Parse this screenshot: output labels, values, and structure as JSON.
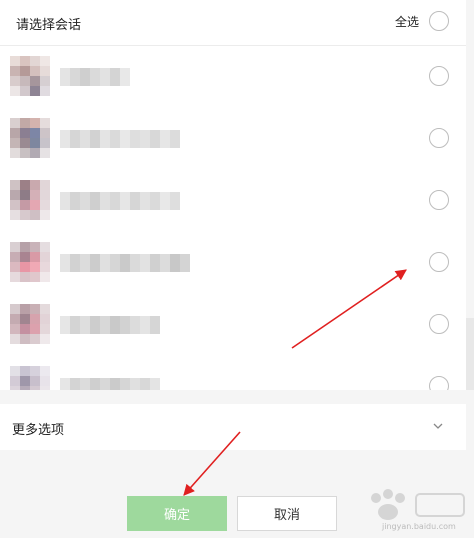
{
  "header": {
    "title": "请选择会话",
    "select_all_label": "全选"
  },
  "more_options": {
    "label": "更多选项"
  },
  "buttons": {
    "confirm_label": "确定",
    "cancel_label": "取消"
  },
  "watermark": {
    "text": "jingyan.baidu.com"
  },
  "colors": {
    "confirm_bg": "#9ed99d",
    "arrow": "#e02020",
    "radio_border": "#bdbdbd"
  }
}
